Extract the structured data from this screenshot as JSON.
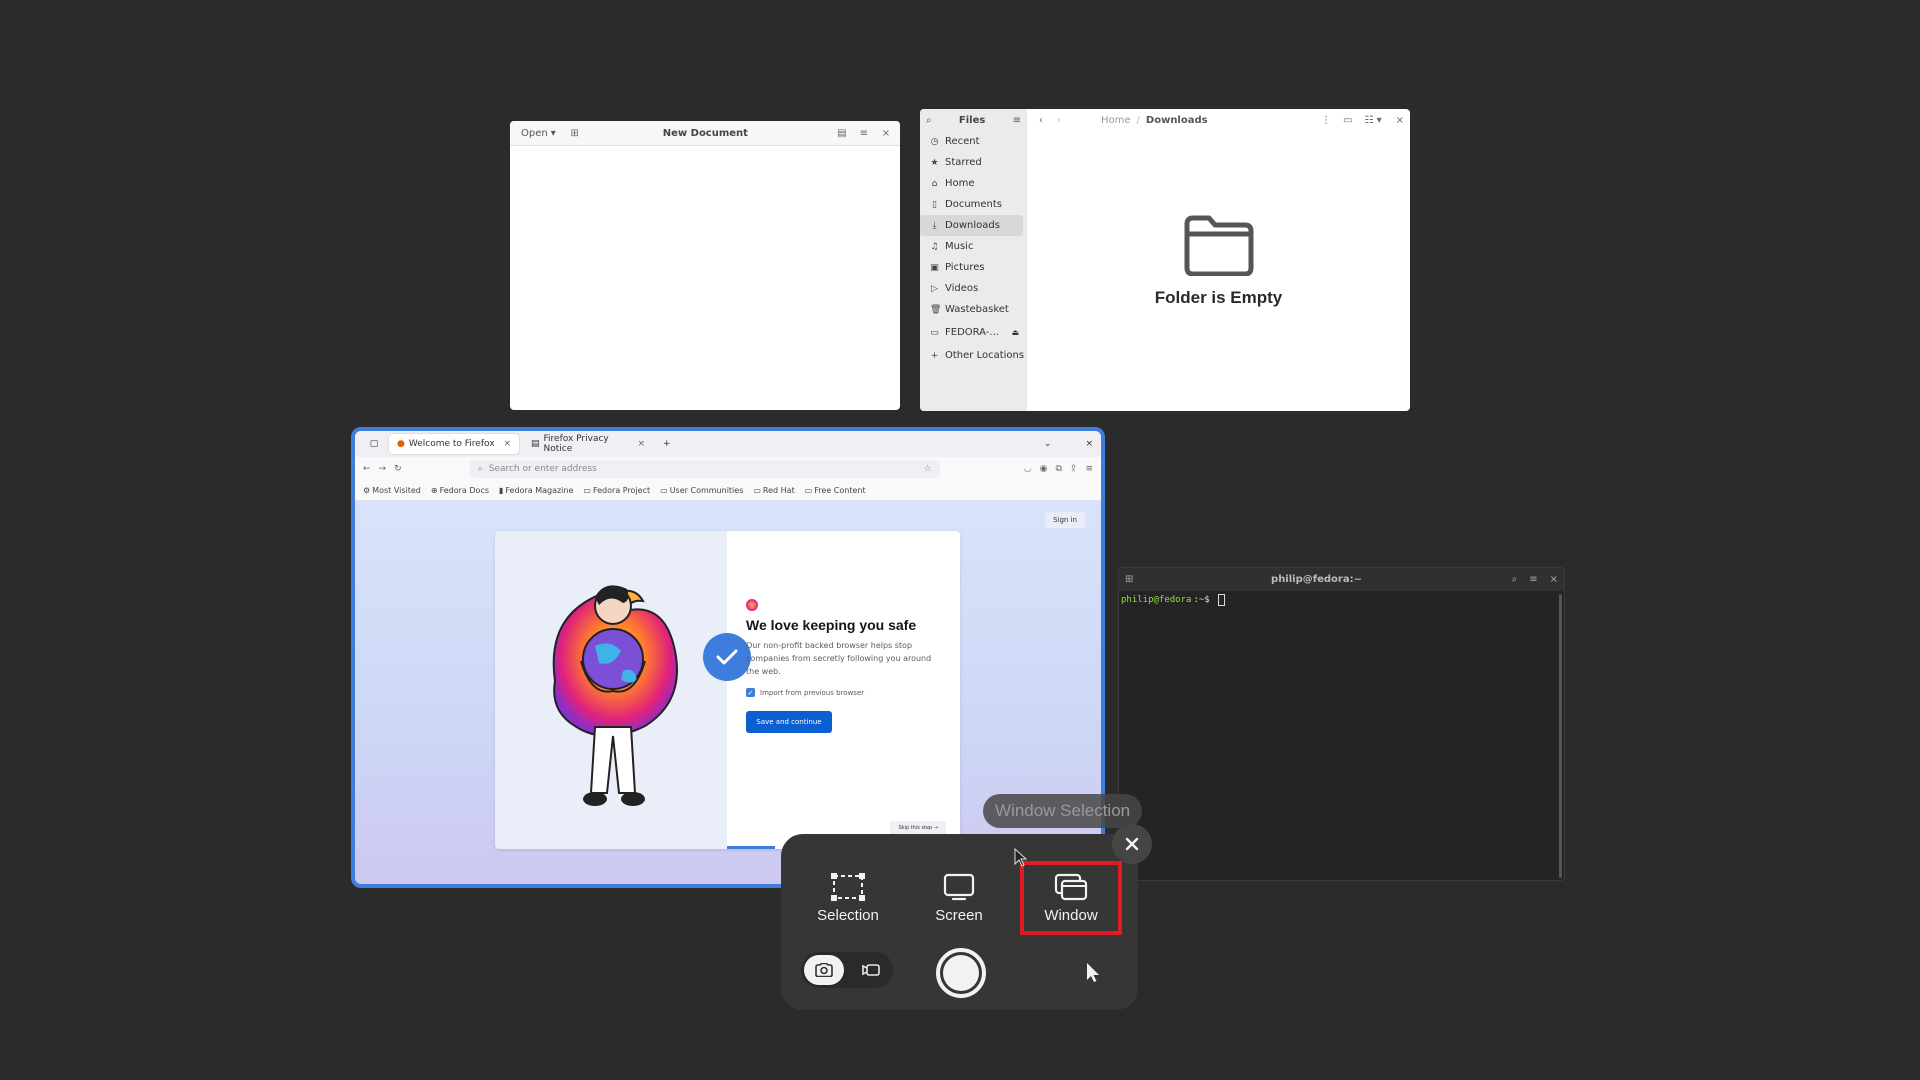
{
  "editor": {
    "open_label": "Open",
    "title": "New Document"
  },
  "files": {
    "title": "Files",
    "breadcrumb": [
      "Home",
      "Downloads"
    ],
    "sidebar": [
      {
        "icon": "clock-icon",
        "glyph": "◷",
        "label": "Recent"
      },
      {
        "icon": "star-icon",
        "glyph": "★",
        "label": "Starred"
      },
      {
        "icon": "home-icon",
        "glyph": "⌂",
        "label": "Home"
      },
      {
        "icon": "document-icon",
        "glyph": "▯",
        "label": "Documents"
      },
      {
        "icon": "download-icon",
        "glyph": "⤓",
        "label": "Downloads",
        "active": true
      },
      {
        "icon": "music-icon",
        "glyph": "♫",
        "label": "Music"
      },
      {
        "icon": "picture-icon",
        "glyph": "▣",
        "label": "Pictures"
      },
      {
        "icon": "video-icon",
        "glyph": "▷",
        "label": "Videos"
      },
      {
        "icon": "trash-icon",
        "glyph": "🗑",
        "label": "Wastebasket"
      }
    ],
    "drive": "FEDORA-...",
    "other_locations": "Other Locations",
    "empty_text": "Folder is Empty"
  },
  "firefox": {
    "tabs": [
      {
        "label": "Welcome to Firefox",
        "active": true
      },
      {
        "label": "Firefox Privacy Notice",
        "active": false
      }
    ],
    "url_placeholder": "Search or enter address",
    "bookmarks": [
      "Most Visited",
      "Fedora Docs",
      "Fedora Magazine",
      "Fedora Project",
      "User Communities",
      "Red Hat",
      "Free Content"
    ],
    "sign_in": "Sign in",
    "heading": "We love keeping you safe",
    "body": "Our non-profit backed browser helps stop companies from secretly following you around the web.",
    "import_label": "Import from previous browser",
    "save_button": "Save and continue",
    "skip_button": "Skip this step →"
  },
  "terminal": {
    "title": "philip@fedora:~",
    "prompt_user": "philip@fedora",
    "prompt_suffix": ":~$"
  },
  "screenshot_ui": {
    "tooltip": "Window Selection",
    "modes": [
      {
        "label": "Selection",
        "icon": "selection-icon"
      },
      {
        "label": "Screen",
        "icon": "screen-icon"
      },
      {
        "label": "Window",
        "icon": "window-icon",
        "selected": true
      }
    ],
    "highlight_color": "#e01b24"
  },
  "colors": {
    "background": "#2b2b2b",
    "firefox_accent": "#3f7ddc"
  }
}
